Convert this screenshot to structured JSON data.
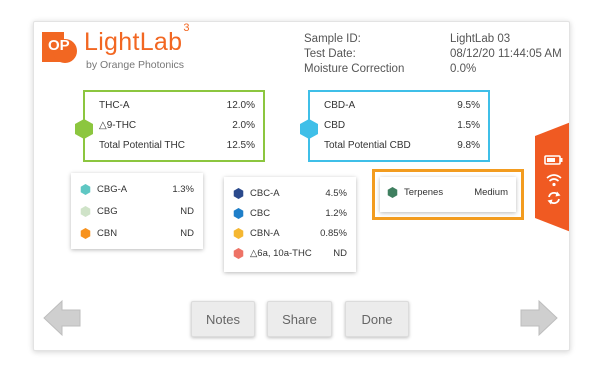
{
  "brand": {
    "name": "LightLab",
    "superscript": "3",
    "tagline": "by Orange Photonics",
    "logo_letters": "OP",
    "color": "#f26722"
  },
  "sample_info": {
    "labels": [
      "Sample ID:",
      "Test Date:",
      "Moisture Correction"
    ],
    "values": [
      "LightLab 03",
      "08/12/20 11:44:05 AM",
      "0.0%"
    ]
  },
  "thc_box": {
    "color": "#8cc63f",
    "rows": [
      {
        "label": "THC-A",
        "value": "12.0%"
      },
      {
        "label": "△9-THC",
        "value": "2.0%"
      },
      {
        "label": "Total Potential THC",
        "value": "12.5%"
      }
    ]
  },
  "cbd_box": {
    "color": "#3fbfe8",
    "rows": [
      {
        "label": "CBD-A",
        "value": "9.5%"
      },
      {
        "label": "CBD",
        "value": "1.5%"
      },
      {
        "label": "Total Potential CBD",
        "value": "9.8%"
      }
    ]
  },
  "card1": {
    "rows": [
      {
        "label": "CBG-A",
        "value": "1.3%",
        "color": "#5fc7c3"
      },
      {
        "label": "CBG",
        "value": "ND",
        "color": "#cfe3c8"
      },
      {
        "label": "CBN",
        "value": "ND",
        "color": "#f7921e"
      }
    ]
  },
  "card2": {
    "rows": [
      {
        "label": "CBC-A",
        "value": "4.5%",
        "color": "#2b4a8c"
      },
      {
        "label": "CBC",
        "value": "1.2%",
        "color": "#1f7fc9"
      },
      {
        "label": "CBN-A",
        "value": "0.85%",
        "color": "#f5b731"
      },
      {
        "label": "△6a, 10a-THC",
        "value": "ND",
        "color": "#ee7366"
      }
    ]
  },
  "terpenes": {
    "label": "Terpenes",
    "value": "Medium",
    "color": "#3f7f5f",
    "highlight": "#f39c1f"
  },
  "side_tab": {
    "color": "#f05a22",
    "icons": [
      "battery-icon",
      "wifi-icon",
      "sync-icon"
    ]
  },
  "buttons": {
    "notes": "Notes",
    "share": "Share",
    "done": "Done"
  }
}
